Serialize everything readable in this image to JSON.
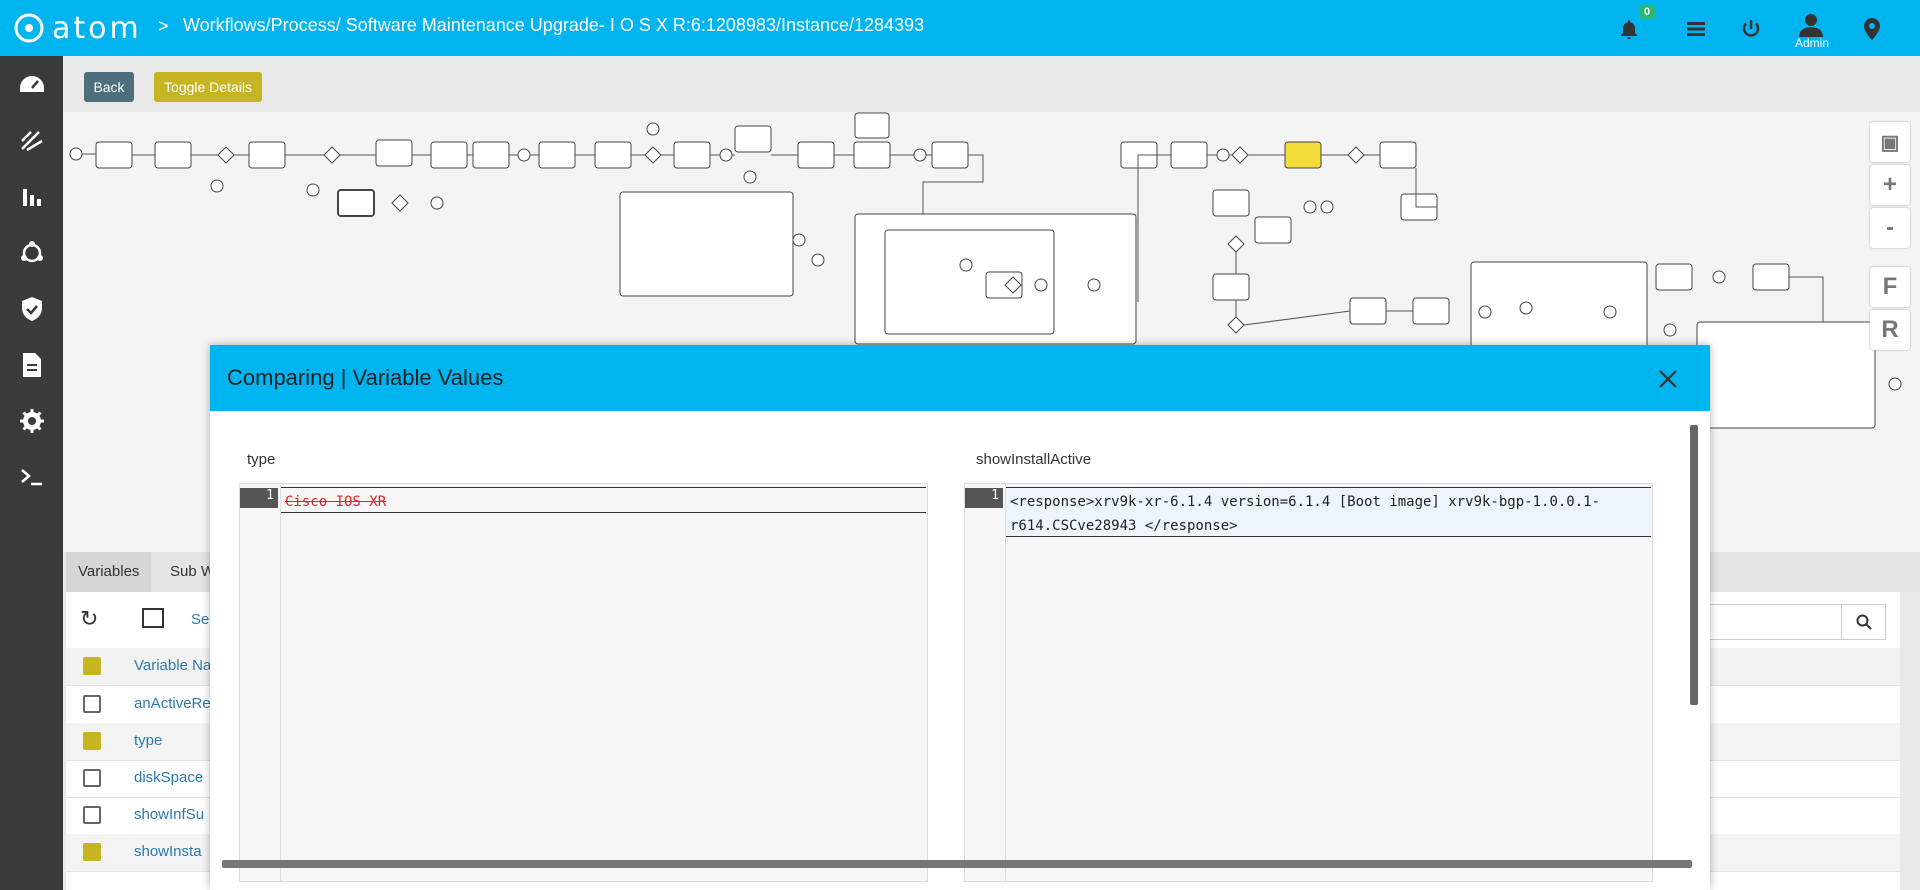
{
  "topbar": {
    "logo_text": "atom",
    "breadcrumb": "Workflows/Process/ Software Maintenance Upgrade- I O S X R:6:1208983/Instance/1284393",
    "notification_count": "0",
    "user_label": "Admin"
  },
  "toolbar": {
    "back_label": "Back",
    "toggle_label": "Toggle Details"
  },
  "diagram": {
    "zoom_in": "+",
    "zoom_out": "-",
    "fit_label": "F",
    "reset_label": "R"
  },
  "lower": {
    "tabs": [
      "Variables",
      "Sub W"
    ],
    "toolbar_text": "Se",
    "column_header": "Variable Na",
    "rows": [
      {
        "name": "anActiveRe",
        "checked": false
      },
      {
        "name": "type",
        "checked": true
      },
      {
        "name": "diskSpace",
        "checked": false
      },
      {
        "name": "showInfSu",
        "checked": false
      },
      {
        "name": "showInsta",
        "checked": true
      }
    ]
  },
  "modal": {
    "title": "Comparing | Variable Values",
    "left": {
      "label": "type",
      "line_number": "1",
      "code": "Cisco IOS XR"
    },
    "right": {
      "label": "showInstallActive",
      "line_number": "1",
      "code": "<response>xrv9k-xr-6.1.4 version=6.1.4 [Boot image] xrv9k-bgp-1.0.0.1-r614.CSCve28943 </response>"
    }
  }
}
